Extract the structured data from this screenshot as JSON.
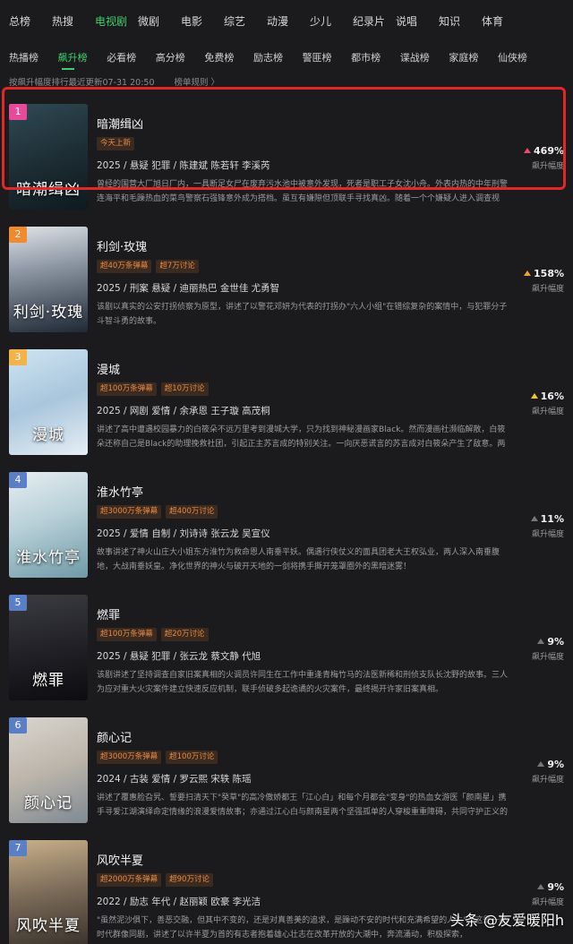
{
  "top_tabs": [
    "总榜",
    "热搜",
    "电视剧",
    "微剧",
    "电影",
    "综艺",
    "动漫",
    "少儿",
    "纪录片",
    "说唱",
    "知识",
    "体育"
  ],
  "top_active": "电视剧",
  "sub_tabs": [
    "热播榜",
    "飙升榜",
    "必看榜",
    "高分榜",
    "免费榜",
    "励志榜",
    "警匪榜",
    "都市榜",
    "谍战榜",
    "家庭榜",
    "仙侠榜"
  ],
  "sub_active": "飙升榜",
  "meta": {
    "update": "按飙升幅度排行最近更新07-31 20:50",
    "rules": "榜单规则 〉"
  },
  "colors": {
    "accent": "#3ecf6e",
    "rank1": "#e84a9a",
    "rank2": "#f08a2c",
    "rank3": "#f2b34a",
    "rank_other": "#5b7fc7",
    "up_red": "#e84a6a",
    "up_orange": "#f0a030",
    "up_yellow": "#f2c430",
    "up_grey": "#777777",
    "highlight": "#e32626"
  },
  "items": [
    {
      "rank": "1",
      "title": "暗潮缉凶",
      "poster_text": "暗潮缉凶",
      "tags": [
        "今天上新"
      ],
      "cast": "2025 / 悬疑 犯罪 / 陈建斌 陈若轩 李溪芮",
      "desc": "曾经的国营大厂旭日厂内，一具断足女尸在废弃污水池中被意外发现，死者是职工子女沈小舟。外表内热的中年刑警连海平和毛躁热血的菜鸟警察石强锋意外成为搭档。虽互有嫌隙但顶联手寻找真凶。随着一个个嫌疑人进入调查视野，…",
      "pct": "469%",
      "pct_label": "飙升幅度"
    },
    {
      "rank": "2",
      "title": "利剑·玫瑰",
      "poster_text": "利剑·玫瑰",
      "tags": [
        "超40万条弹幕",
        "超7万讨论"
      ],
      "cast": "2025 / 刑案 悬疑 / 迪丽热巴 金世佳 尤勇智",
      "desc": "该剧以真实的公安打拐侦察为原型，讲述了以警花邓妍为代表的打拐办\"六人小组\"在错综复杂的案情中，与犯罪分子斗智斗勇的故事。",
      "pct": "158%",
      "pct_label": "飙升幅度"
    },
    {
      "rank": "3",
      "title": "漫城",
      "poster_text": "漫城",
      "tags": [
        "超100万条弹幕",
        "超10万讨论"
      ],
      "cast": "2025 / 网剧 爱情 / 余承恩 王子璇 高茂桐",
      "desc": "讲述了高中遭遇校园暴力的白筱朵不远万里考到漫城大学，只为找到神秘漫画家Black。然而漫画社濒临解散，白筱朵还称自己是Black的助理挽救社团，引起正主苏言成的特别关注。一向厌恶谎言的苏言成对白筱朵产生了敌意。两人见招…",
      "pct": "16%",
      "pct_label": "飙升幅度"
    },
    {
      "rank": "4",
      "title": "淮水竹亭",
      "poster_text": "淮水竹亭",
      "tags": [
        "超3000万条弹幕",
        "超400万讨论"
      ],
      "cast": "2025 / 爱情 自制 / 刘诗诗 张云龙 吴宣仪",
      "desc": "故事讲述了神火山庄大小姐东方淮竹为救命恩人南垂平妖。偶遇行侠仗义的面具团老大王权弘业，两人深入南垂腹地，大战南垂妖皇。净化世界的神火与破开天地的一剑将携手撕开笼罩圈外的黑暗迷雾！",
      "pct": "11%",
      "pct_label": "飙升幅度"
    },
    {
      "rank": "5",
      "title": "燃罪",
      "poster_text": "燃罪",
      "tags": [
        "超100万条弹幕",
        "超20万讨论"
      ],
      "cast": "2025 / 悬疑 犯罪 / 张云龙 蔡文静 代旭",
      "desc": "该剧讲述了坚持调查自家旧案真相的火调员许同生在工作中重逢青梅竹马的法医新稀和刑侦支队长沈野的故事。三人为应对重大火灾案件建立快速反应机制，联手侦破多起诡谲的火灾案件，最终揭开许家旧案真相。",
      "pct": "9%",
      "pct_label": "飙升幅度"
    },
    {
      "rank": "6",
      "title": "颜心记",
      "poster_text": "颜心记",
      "tags": [
        "超3000万条弹幕",
        "超100万讨论"
      ],
      "cast": "2024 / 古装 爱情 / 罗云熙 宋轶 陈瑶",
      "desc": "讲述了覆惠脸旮旯、誓要扫清天下\"癸草\"的高冷傲娇都王「江心白」和每个月都会\"变身\"的热血女游医「颜南星」携手寻爱江湖演绎命定情缘的浪漫爱情故事；亦通过江心白与颜南星两个坚强孤单的人穿梭重重障碍，共同守护正义的过程，…",
      "pct": "9%",
      "pct_label": "飙升幅度"
    },
    {
      "rank": "7",
      "title": "风吹半夏",
      "poster_text": "风吹半夏",
      "tags": [
        "超2000万条弹幕",
        "超90万讨论"
      ],
      "cast": "2022 / 励志 年代 / 赵丽颖 欧豪 李光洁",
      "desc": "\"虽然泥沙俱下，善恶交融，但其中不变的，还是对真善美的追求，是躁动不安的时代和充满希望的人生\"。这是一部时代群像同剧，讲述了以许半夏为首的有志者抱着雄心壮志在改革开放的大潮中，奔流涌动，积极探索，",
      "pct": "9%",
      "pct_label": "飙升幅度"
    }
  ],
  "watermark": "头条 @友爱暖阳h"
}
